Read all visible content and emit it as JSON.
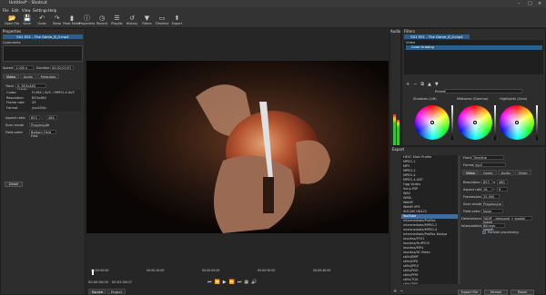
{
  "window": {
    "title": "Untitled* - Shotcut"
  },
  "menu": [
    "File",
    "Edit",
    "View",
    "Settings",
    "Help"
  ],
  "toolbar": [
    {
      "label": "Open File",
      "icon": "folder-open-icon",
      "glyph": "📂"
    },
    {
      "label": "Save",
      "icon": "save-icon",
      "glyph": "💾"
    },
    {
      "label": "Undo",
      "icon": "undo-icon",
      "glyph": "↶"
    },
    {
      "label": "Redo",
      "icon": "redo-icon",
      "glyph": "↷"
    },
    {
      "label": "Peak Meter",
      "icon": "meter-icon",
      "glyph": "▮"
    },
    {
      "label": "Properties",
      "icon": "info-icon",
      "glyph": "ⓘ"
    },
    {
      "label": "Recent",
      "icon": "clock-icon",
      "glyph": "◷"
    },
    {
      "label": "Playlist",
      "icon": "list-icon",
      "glyph": "☰"
    },
    {
      "label": "History",
      "icon": "history-icon",
      "glyph": "↺"
    },
    {
      "label": "Filters",
      "icon": "filter-icon",
      "glyph": "▼"
    },
    {
      "label": "Timeline",
      "icon": "timeline-icon",
      "glyph": "▭"
    },
    {
      "label": "Export",
      "icon": "export-icon",
      "glyph": "⬆"
    }
  ],
  "properties": {
    "title": "Properties",
    "clip_name": "S01 E01 - The Game_8_0.mp4",
    "comments_label": "Comments",
    "speed_label": "Speed",
    "speed_value": "1.000 x",
    "duration_label": "Duration",
    "duration_value": "00:02:03:07",
    "tabs": [
      "Video",
      "Audio",
      "Metadata"
    ],
    "track_label": "Track",
    "track_value": "0: 853x480 (16:9)",
    "codec_rows": [
      {
        "k": "Codec",
        "v": "H.264 / AVC / MPEG-4 AVC"
      },
      {
        "k": "Resolution",
        "v": "853x480"
      },
      {
        "k": "Frame rate",
        "v": "25"
      },
      {
        "k": "Format",
        "v": "yuv420p"
      }
    ],
    "aspect_label": "Aspect ratio",
    "aspect_w": "853",
    "aspect_h": "480",
    "scan_label": "Scan mode",
    "scan_value": "Progressive",
    "field_label": "Field order",
    "field_value": "Bottom Field First",
    "detail_button": "Detail"
  },
  "audio": {
    "title": "Audio"
  },
  "filters": {
    "title": "Filters",
    "clip_name": "S01 E01 - The Game_8_0.mp4",
    "group": "Video",
    "item": "Color Grading",
    "preset_label": "Preset",
    "wheels": [
      "Shadows (Lift)",
      "Midtones (Gamma)",
      "Highlights (Gain)"
    ]
  },
  "export": {
    "title": "Export",
    "formats": [
      "HEVC Main Profile",
      "MPEG-2",
      "MP3",
      "MPEG-2",
      "MPEG-4",
      "MPEG-4-ASP",
      "Ogg Vorbis",
      "Sony-PSP",
      "WAV",
      "WMA",
      "WebM",
      "WebM VP9",
      "XDCAM HD422",
      "YouTube",
      "intermediate/ProRes",
      "intermediate/MPEG-2",
      "intermediate/MPEG-4",
      "intermediate/ProRes Kostya",
      "lossless/FFV1",
      "lossless/HuffYUV",
      "lossless/MP4",
      "lossless/Ut Video",
      "stills/BMP",
      "stills/DPX",
      "stills/JPEG",
      "stills/PNG",
      "stills/PPM",
      "stills/TGA",
      "stills/TIFF"
    ],
    "selected_index": 13,
    "from_label": "From",
    "from_value": "Timeline",
    "format_label": "Format",
    "format_value": "mp4",
    "tabs": [
      "Video",
      "Codec",
      "Audio",
      "Other"
    ],
    "resolution_label": "Resolution",
    "res_w": "853",
    "res_h": "480",
    "aspect_label": "Aspect ratio",
    "aspect_w": "16",
    "aspect_h": "9",
    "fps_label": "Frames/sec",
    "fps_value": "25.000",
    "scan_label": "Scan mode",
    "scan_value": "Progressive",
    "field_label": "Field order",
    "field_value": "None",
    "deint_label": "Deinterlacer",
    "deint_value": "YADIF - temporal + spatial (best)",
    "interp_label": "Interpolation",
    "interp_value": "Bilinear (good)",
    "parallel_label": "Parallel processing",
    "buttons": [
      "Export File",
      "Stream",
      "Reset"
    ]
  },
  "player": {
    "ticks": [
      "00:00:00:00",
      "00:00:10:00",
      "00:00:20:00",
      "00:00:30:00",
      "00:00:40:00"
    ],
    "position": "00:00:00:00",
    "duration": "00:02:03:07",
    "tabs": [
      "Source",
      "Project"
    ]
  }
}
